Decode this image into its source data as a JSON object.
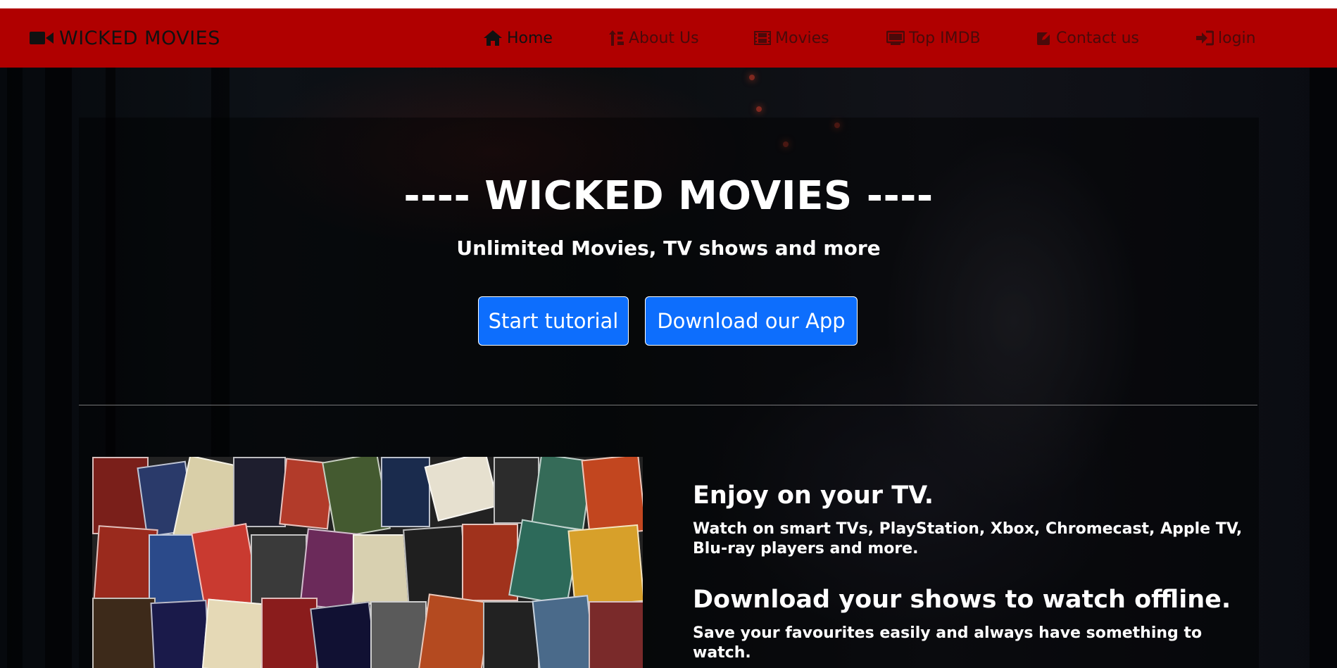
{
  "brand": {
    "name": "WICKED MOVIES",
    "icon": "video-camera-icon"
  },
  "nav": {
    "items": [
      {
        "label": "Home",
        "icon": "home-icon",
        "active": true
      },
      {
        "label": "About Us",
        "icon": "sort-icon",
        "active": false
      },
      {
        "label": "Movies",
        "icon": "film-icon",
        "active": false
      },
      {
        "label": "Top IMDB",
        "icon": "tv-icon",
        "active": false
      },
      {
        "label": "Contact us",
        "icon": "edit-icon",
        "active": false
      },
      {
        "label": "login",
        "icon": "sign-in-icon",
        "active": false
      }
    ]
  },
  "hero": {
    "title": "---- WICKED MOVIES ----",
    "subtitle": "Unlimited Movies, TV shows and more",
    "buttons": {
      "tutorial": "Start tutorial",
      "download": "Download our App"
    }
  },
  "features": [
    {
      "title": "Enjoy on your TV.",
      "text": "Watch on smart TVs, PlayStation, Xbox, Chromecast, Apple TV, Blu-ray players and more."
    },
    {
      "title": "Download your shows to watch offline.",
      "text": "Save your favourites easily and always have something to watch."
    }
  ],
  "colors": {
    "navbar": "#b00000",
    "button": "#0d6efd",
    "text": "#ffffff"
  }
}
